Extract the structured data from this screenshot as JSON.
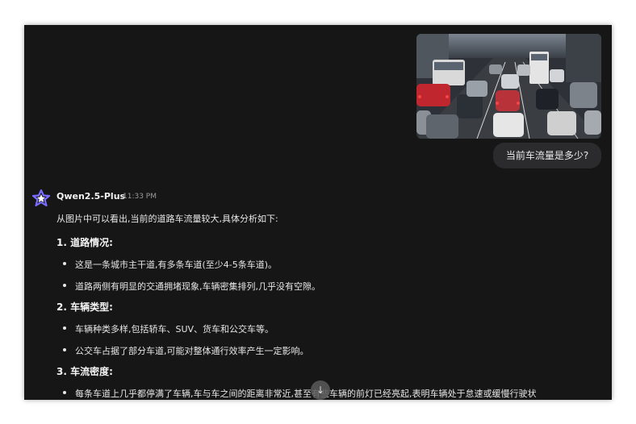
{
  "user_message": {
    "image_alt": "traffic-jam-photo",
    "text": "当前车流量是多少?"
  },
  "assistant": {
    "model_name": "Qwen2.5-Plus",
    "time": "11:33 PM",
    "intro": "从图片中可以看出,当前的道路车流量较大,具体分析如下:",
    "sections": [
      {
        "heading": "1. 道路情况:",
        "bullets": [
          "这是一条城市主干道,有多条车道(至少4-5条车道)。",
          "道路两侧有明显的交通拥堵现象,车辆密集排列,几乎没有空隙。"
        ]
      },
      {
        "heading": "2. 车辆类型:",
        "bullets": [
          "车辆种类多样,包括轿车、SUV、货车和公交车等。",
          "公交车占据了部分车道,可能对整体通行效率产生一定影响。"
        ]
      },
      {
        "heading": "3. 车流密度:",
        "bullets": [
          "每条车道上几乎都停满了车辆,车与车之间的距离非常近,甚至有些车辆的前灯已经亮起,表明车辆处于怠速或缓慢行驶状"
        ]
      }
    ]
  },
  "controls": {
    "scroll_down_glyph": "↓"
  },
  "colors": {
    "window_bg": "#161616",
    "bubble_bg": "#2b2b2d",
    "text": "#e6e6e6",
    "logo_purple": "#6b5cff"
  }
}
